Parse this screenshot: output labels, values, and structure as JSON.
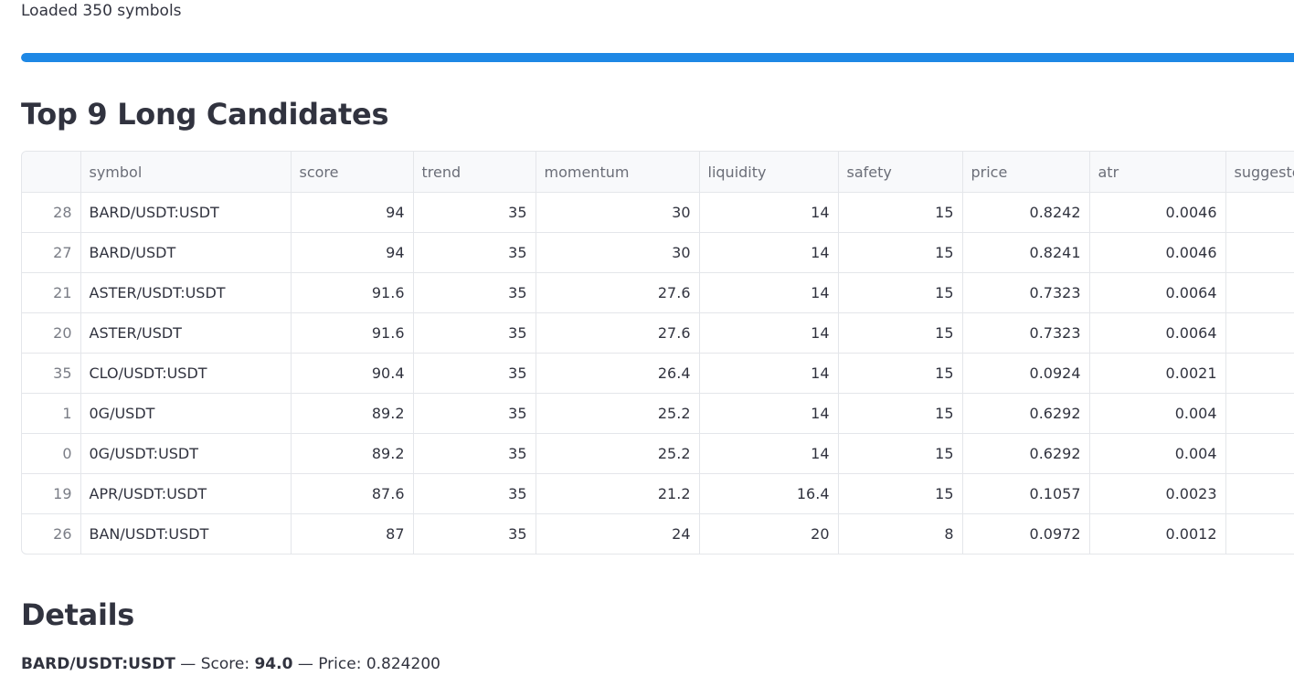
{
  "status": {
    "message": "Loaded 350 symbols",
    "progress_percent": 100,
    "progress_color": "#1e88e5"
  },
  "top_section": {
    "title": "Top 9 Long Candidates"
  },
  "table": {
    "columns": [
      "",
      "symbol",
      "score",
      "trend",
      "momentum",
      "liquidity",
      "safety",
      "price",
      "atr",
      "suggested"
    ],
    "rows": [
      {
        "index": "28",
        "symbol": "BARD/USDT:USDT",
        "score": "94",
        "trend": "35",
        "momentum": "30",
        "liquidity": "14",
        "safety": "15",
        "price": "0.8242",
        "atr": "0.0046",
        "suggested": ""
      },
      {
        "index": "27",
        "symbol": "BARD/USDT",
        "score": "94",
        "trend": "35",
        "momentum": "30",
        "liquidity": "14",
        "safety": "15",
        "price": "0.8241",
        "atr": "0.0046",
        "suggested": ""
      },
      {
        "index": "21",
        "symbol": "ASTER/USDT:USDT",
        "score": "91.6",
        "trend": "35",
        "momentum": "27.6",
        "liquidity": "14",
        "safety": "15",
        "price": "0.7323",
        "atr": "0.0064",
        "suggested": ""
      },
      {
        "index": "20",
        "symbol": "ASTER/USDT",
        "score": "91.6",
        "trend": "35",
        "momentum": "27.6",
        "liquidity": "14",
        "safety": "15",
        "price": "0.7323",
        "atr": "0.0064",
        "suggested": ""
      },
      {
        "index": "35",
        "symbol": "CLO/USDT:USDT",
        "score": "90.4",
        "trend": "35",
        "momentum": "26.4",
        "liquidity": "14",
        "safety": "15",
        "price": "0.0924",
        "atr": "0.0021",
        "suggested": ""
      },
      {
        "index": "1",
        "symbol": "0G/USDT",
        "score": "89.2",
        "trend": "35",
        "momentum": "25.2",
        "liquidity": "14",
        "safety": "15",
        "price": "0.6292",
        "atr": "0.004",
        "suggested": ""
      },
      {
        "index": "0",
        "symbol": "0G/USDT:USDT",
        "score": "89.2",
        "trend": "35",
        "momentum": "25.2",
        "liquidity": "14",
        "safety": "15",
        "price": "0.6292",
        "atr": "0.004",
        "suggested": ""
      },
      {
        "index": "19",
        "symbol": "APR/USDT:USDT",
        "score": "87.6",
        "trend": "35",
        "momentum": "21.2",
        "liquidity": "16.4",
        "safety": "15",
        "price": "0.1057",
        "atr": "0.0023",
        "suggested": ""
      },
      {
        "index": "26",
        "symbol": "BAN/USDT:USDT",
        "score": "87",
        "trend": "35",
        "momentum": "24",
        "liquidity": "20",
        "safety": "8",
        "price": "0.0972",
        "atr": "0.0012",
        "suggested": ""
      }
    ]
  },
  "details": {
    "title": "Details",
    "symbol": "BARD/USDT:USDT",
    "sep1": " — Score: ",
    "score": "94.0",
    "sep2": " — Price: 0.824200"
  }
}
